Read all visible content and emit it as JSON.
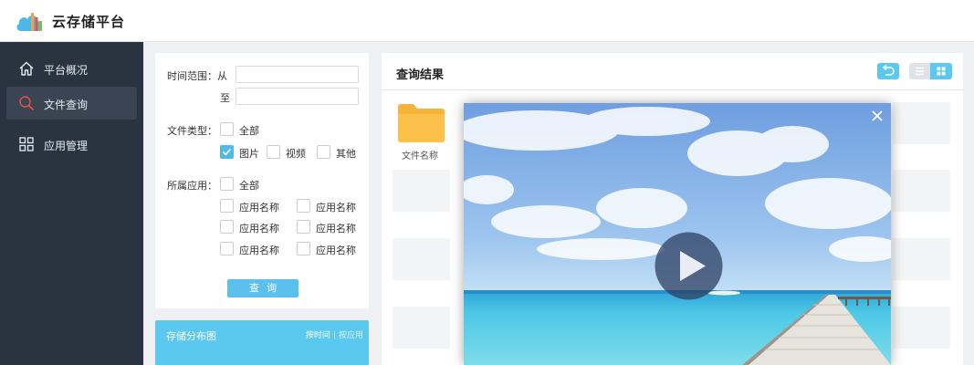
{
  "app": {
    "title": "云存储平台",
    "logo_icon": "cloud-bars-logo"
  },
  "sidebar": {
    "items": [
      {
        "label": "平台概况",
        "icon": "home-icon",
        "active": false
      },
      {
        "label": "文件查询",
        "icon": "search-icon",
        "active": true
      },
      {
        "label": "应用管理",
        "icon": "grid-icon",
        "active": false
      }
    ]
  },
  "filter": {
    "time_range_label": "时间范围：从",
    "to_label": "至",
    "from_value": "",
    "to_value": "",
    "file_type_label": "文件类型：",
    "file_types": [
      {
        "label": "全部",
        "checked": false
      },
      {
        "label": "图片",
        "checked": true
      },
      {
        "label": "视频",
        "checked": false
      },
      {
        "label": "其他",
        "checked": false
      }
    ],
    "app_label": "所属应用：",
    "apps": [
      {
        "label": "全部",
        "checked": false
      },
      {
        "label": "应用名称",
        "checked": false
      },
      {
        "label": "应用名称",
        "checked": false
      },
      {
        "label": "应用名称",
        "checked": false
      },
      {
        "label": "应用名称",
        "checked": false
      },
      {
        "label": "应用名称",
        "checked": false
      },
      {
        "label": "应用名称",
        "checked": false
      }
    ],
    "query_button": "查询"
  },
  "distribution": {
    "title": "存储分布图",
    "by_time": "按时间",
    "separator": "|",
    "by_app": "按应用"
  },
  "results": {
    "title": "查询结果",
    "back_icon": "undo-icon",
    "list_view_icon": "list-icon",
    "grid_view_icon": "grid-view-icon",
    "folder_label": "文件名称"
  },
  "modal": {
    "close_icon": "close-icon",
    "play_icon": "play-icon"
  },
  "colors": {
    "accent": "#5bc8ef",
    "sidebar_bg": "#2a3441",
    "folder": "#f7b43a"
  }
}
